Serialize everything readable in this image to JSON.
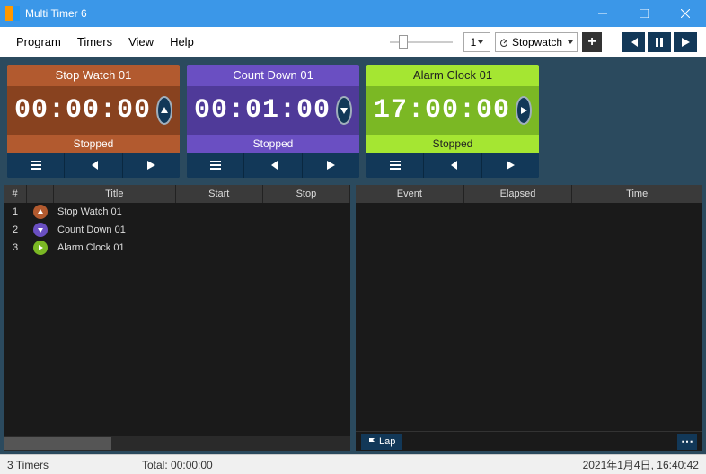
{
  "window": {
    "title": "Multi Timer 6"
  },
  "menu": {
    "program": "Program",
    "timers": "Timers",
    "view": "View",
    "help": "Help"
  },
  "toolbar": {
    "count": "1",
    "mode": "Stopwatch",
    "plus": "+"
  },
  "cards": [
    {
      "title": "Stop Watch 01",
      "time": "00:00:00",
      "status": "Stopped"
    },
    {
      "title": "Count Down 01",
      "time": "00:01:00",
      "status": "Stopped"
    },
    {
      "title": "Alarm Clock 01",
      "time": "17:00:00",
      "status": "Stopped"
    }
  ],
  "leftTable": {
    "headers": {
      "num": "#",
      "title": "Title",
      "start": "Start",
      "stop": "Stop"
    },
    "rows": [
      {
        "n": "1",
        "title": "Stop Watch 01"
      },
      {
        "n": "2",
        "title": "Count Down 01"
      },
      {
        "n": "3",
        "title": "Alarm Clock 01"
      }
    ]
  },
  "rightTable": {
    "headers": {
      "event": "Event",
      "elapsed": "Elapsed",
      "time": "Time"
    }
  },
  "lap": "Lap",
  "status": {
    "count": "3 Timers",
    "total": "Total: 00:00:00",
    "clock": "2021年1月4日, 16:40:42"
  }
}
